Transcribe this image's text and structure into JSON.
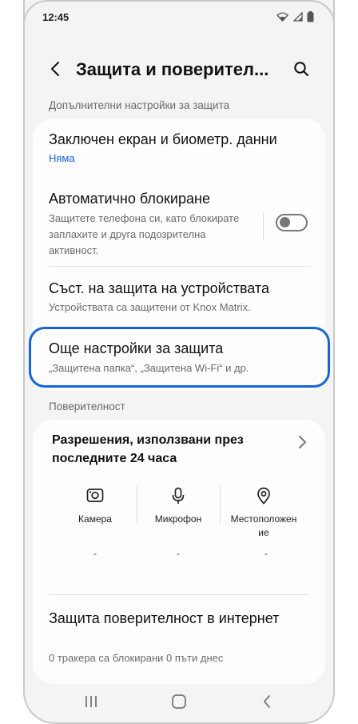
{
  "status_bar": {
    "time": "12:45"
  },
  "header": {
    "title": "Защита и поверител..."
  },
  "sections": {
    "additional_security": "Допълнителни настройки за защита",
    "privacy": "Поверителност"
  },
  "security_items": [
    {
      "title": "Заключен екран и биометр. данни",
      "subtitle": "Няма"
    },
    {
      "title": "Автоматично блокиране",
      "subtitle": "Защитете телефона си, като блокирате заплахите и друга подозрителна активност."
    },
    {
      "title": "Съст. на защита на устройствата",
      "subtitle": "Устройствата са защитени от Knox Matrix."
    },
    {
      "title": "Още настройки за защита",
      "subtitle": "„Защитена папка“, „Защитена Wi-Fi“ и др."
    }
  ],
  "auto_block_toggle": {
    "state": "off"
  },
  "permissions": {
    "title": "Разрешения, използвани през последните 24 часа",
    "items": [
      {
        "label": "Камера",
        "value": "-",
        "icon": "camera-icon"
      },
      {
        "label": "Микрофон",
        "value": "-",
        "icon": "microphone-icon"
      },
      {
        "label": "Местоположение",
        "value": "-",
        "icon": "location-icon"
      }
    ]
  },
  "internet_privacy": {
    "title": "Защита поверителност в интернет",
    "subtitle": "0 тракера са блокирани 0 пъти днес"
  },
  "colors": {
    "accent": "#1565d8",
    "link": "#1b5fd1",
    "background": "#f4f4f4",
    "card": "#fdfdfd"
  }
}
